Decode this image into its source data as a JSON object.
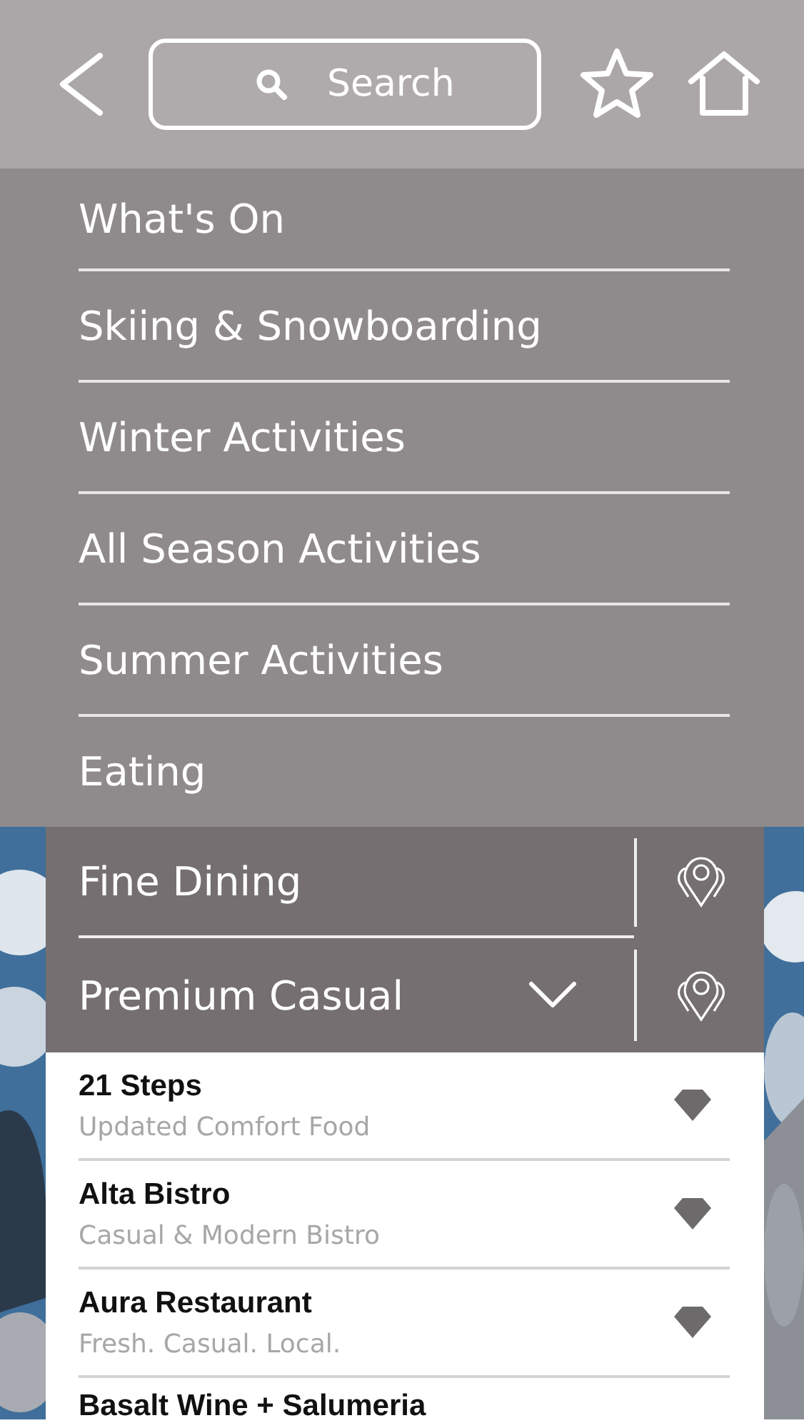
{
  "header": {
    "search": {
      "placeholder": "Search"
    }
  },
  "menu": [
    {
      "label": "What's On"
    },
    {
      "label": "Skiing & Snowboarding"
    },
    {
      "label": "Winter Activities"
    },
    {
      "label": "All Season Activities"
    },
    {
      "label": "Summer Activities"
    },
    {
      "label": "Eating",
      "children": [
        {
          "label": "Fine Dining",
          "expanded": false
        },
        {
          "label": "Premium Casual",
          "expanded": true,
          "children": [
            {
              "name": "21 Steps",
              "description": "Updated Comfort Food"
            },
            {
              "name": "Alta Bistro",
              "description": "Casual & Modern Bistro"
            },
            {
              "name": "Aura Restaurant",
              "description": "Fresh. Casual. Local."
            },
            {
              "name": "Basalt Wine + Salumeria"
            }
          ]
        }
      ]
    }
  ]
}
